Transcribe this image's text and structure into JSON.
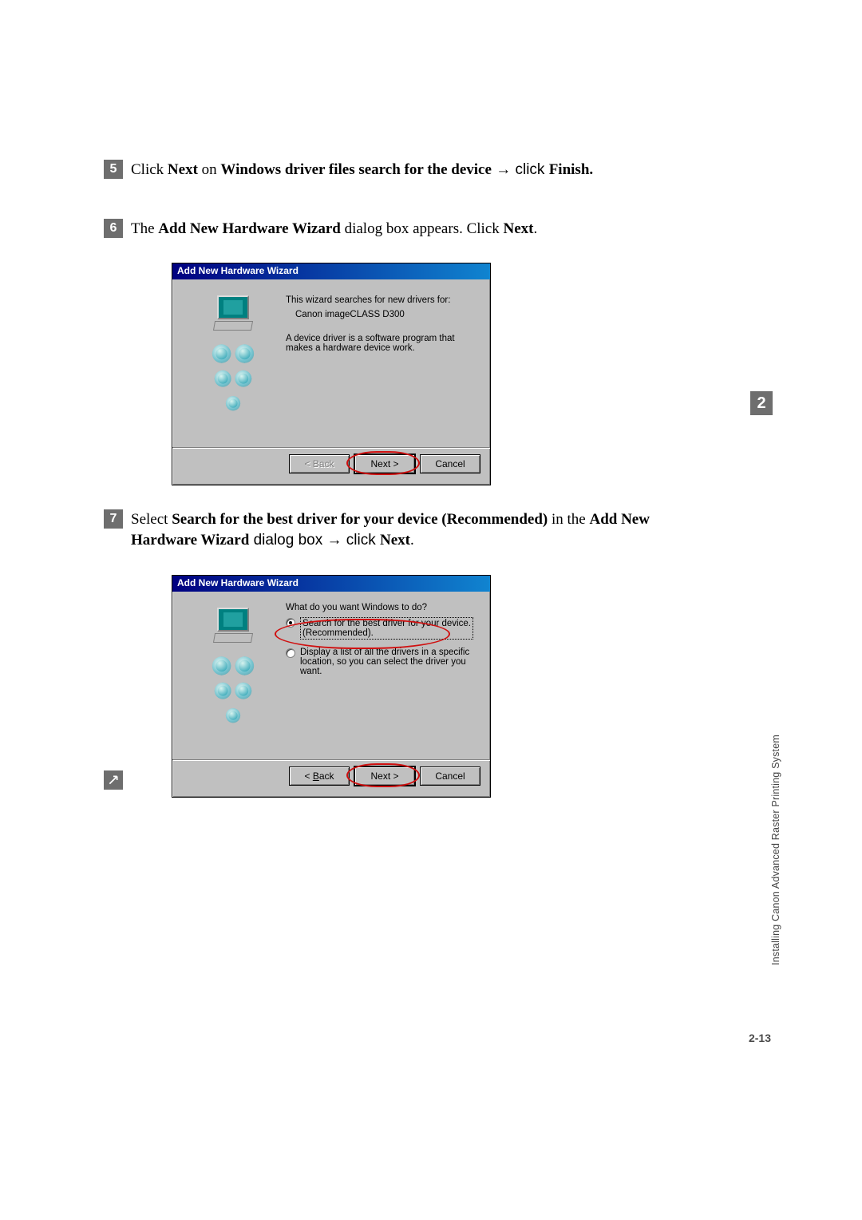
{
  "steps": {
    "s5": {
      "num": "5",
      "t1": "Click ",
      "t2": "Next",
      "t3": " on ",
      "t4": "Windows driver files search for the device",
      "t5": " → click ",
      "t6": "Finish."
    },
    "s6": {
      "num": "6",
      "t1": "The ",
      "t2": "Add New Hardware Wizard",
      "t3": " dialog box appears. Click ",
      "t4": "Next",
      "t5": "."
    },
    "s7": {
      "num": "7",
      "t1": "Select ",
      "t2": "Search for the best driver for your device (Recommended)",
      "t3": " in the ",
      "t4": "Add New Hardware Wizard",
      "t5": " dialog box → click ",
      "t6": "Next",
      "t7": "."
    }
  },
  "dialog1": {
    "title": "Add New Hardware Wizard",
    "line1": "This wizard searches for new drivers for:",
    "device": "Canon imageCLASS D300",
    "line2": "A device driver is a software program that makes a hardware device work.",
    "back": "< Back",
    "next": "Next >",
    "cancel": "Cancel"
  },
  "dialog2": {
    "title": "Add New Hardware Wizard",
    "prompt": "What do you want Windows to do?",
    "opt1a": "Search for the best driver for your device.",
    "opt1b": "(Recommended).",
    "opt2": "Display a list of all the drivers in a specific location, so you can select the driver you want.",
    "back_u": "B",
    "back_rest": "ack",
    "back_pre": "< ",
    "next": "Next >",
    "cancel": "Cancel"
  },
  "side": {
    "text": "Installing Canon Advanced Raster Printing System",
    "chapter": "2"
  },
  "pagenum": "2-13"
}
